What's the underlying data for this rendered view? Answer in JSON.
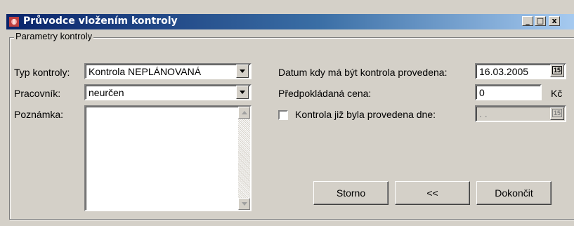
{
  "window": {
    "title": "Průvodce vložením kontroly",
    "controls": {
      "minimize": "_",
      "maximize": "□",
      "close": "x"
    }
  },
  "group": {
    "legend": "Parametry kontroly"
  },
  "left": {
    "typ_label": "Typ kontroly:",
    "typ_value": "Kontrola NEPLÁNOVANÁ",
    "pracovnik_label": "Pracovník:",
    "pracovnik_value": "neurčen",
    "poznamka_label": "Poznámka:",
    "poznamka_value": ""
  },
  "right": {
    "datum_label": "Datum kdy má být kontrola provedena:",
    "datum_value": "16.03.2005",
    "cena_label": "Předpokládaná cena:",
    "cena_value": "0",
    "cena_unit": "Kč",
    "provedena_label": "Kontrola již byla provedena dne:",
    "provedena_checked": false,
    "provedena_value": ". .",
    "calendar_icon_text": "15"
  },
  "buttons": {
    "storno": "Storno",
    "back": "<<",
    "dokoncit": "Dokončit"
  }
}
